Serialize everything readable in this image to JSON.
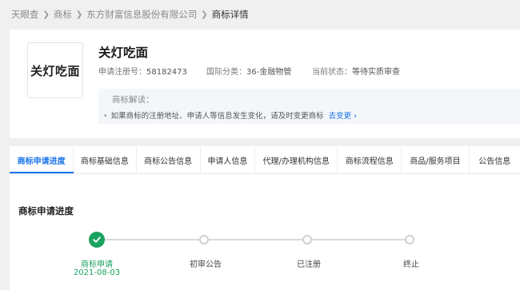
{
  "breadcrumb": {
    "items": [
      "天眼查",
      "商标",
      "东方财富信息股份有限公司",
      "商标详情"
    ]
  },
  "trademark": {
    "logo_text": "关灯吃面",
    "name": "关灯吃面",
    "reg_no_label": "申请注册号：",
    "reg_no": "58182473",
    "class_label": "国际分类：",
    "class_value": "36-金融物管",
    "status_label": "当前状态：",
    "status_value": "等待实质审查"
  },
  "interpretation": {
    "label": "商标解读：",
    "desc": "如果商标的注册地址、申请人等信息发生变化，请及时变更商标",
    "link": "去变更"
  },
  "tabs": [
    {
      "label": "商标申请进度",
      "active": true
    },
    {
      "label": "商标基础信息",
      "active": false
    },
    {
      "label": "商标公告信息",
      "active": false
    },
    {
      "label": "申请人信息",
      "active": false
    },
    {
      "label": "代理/办理机构信息",
      "active": false
    },
    {
      "label": "商标流程信息",
      "active": false
    },
    {
      "label": "商品/服务项目",
      "active": false
    },
    {
      "label": "公告信息",
      "active": false
    }
  ],
  "progress": {
    "title": "商标申请进度",
    "steps": [
      {
        "label": "商标申请",
        "date": "2021-08-03",
        "done": true
      },
      {
        "label": "初审公告",
        "date": "",
        "done": false
      },
      {
        "label": "已注册",
        "date": "",
        "done": false
      },
      {
        "label": "终止",
        "date": "",
        "done": false
      }
    ]
  },
  "colors": {
    "accent": "#1a73e8",
    "done": "#1aa260"
  },
  "icons": {
    "breadcrumb_separator": "chevron-right-icon",
    "link_arrow": "chevron-right-icon",
    "step_done": "check-icon"
  }
}
